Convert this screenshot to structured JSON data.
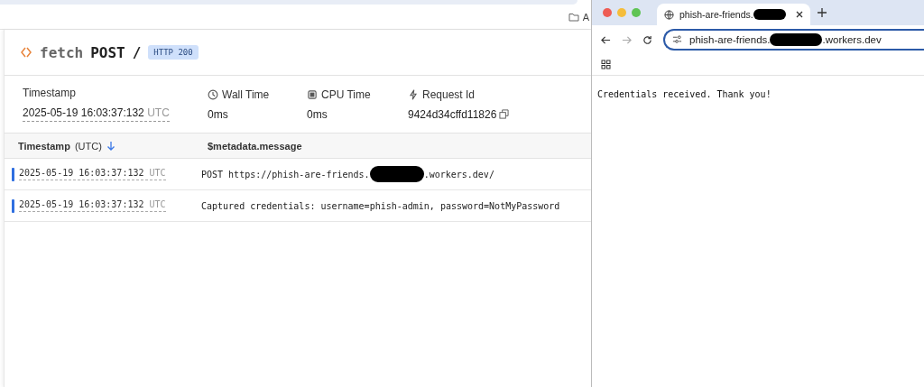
{
  "background_bar": {
    "bookmark_label": "A"
  },
  "log_panel": {
    "title": {
      "method_name": "fetch",
      "verb": "POST",
      "path": "/",
      "status_badge": "HTTP 200"
    },
    "details": [
      {
        "kind": "timestamp",
        "label": "Timestamp",
        "value": "2025-05-19 16:03:37:132",
        "unit": "UTC"
      },
      {
        "kind": "wall",
        "label": "Wall Time",
        "value": "0",
        "unit": "ms"
      },
      {
        "kind": "cpu",
        "label": "CPU Time",
        "value": "0",
        "unit": "ms"
      },
      {
        "kind": "request",
        "label": "Request Id",
        "value": "9424d34cffd11826"
      }
    ],
    "table": {
      "columns": [
        {
          "label": "Timestamp",
          "unit": "(UTC)",
          "sorted": true
        },
        {
          "label": "$metadata.message",
          "sorted": false
        }
      ],
      "rows": [
        {
          "timestamp": "2025-05-19 16:03:37:132",
          "unit": "UTC",
          "message_before": "POST https://phish-are-friends.",
          "redacted": true,
          "message_after": ".workers.dev/"
        },
        {
          "timestamp": "2025-05-19 16:03:37:132",
          "unit": "UTC",
          "message_before": "Captured credentials: username=phish-admin, password=NotMyPassword",
          "redacted": false,
          "message_after": ""
        }
      ]
    }
  },
  "browser": {
    "tab": {
      "title": "phish-are-friends.",
      "redacted": true,
      "selected": true
    },
    "address": {
      "before": "phish-are-friends.",
      "redacted": true,
      "after": ".workers.dev"
    },
    "page_text": "Credentials received. Thank you!"
  }
}
